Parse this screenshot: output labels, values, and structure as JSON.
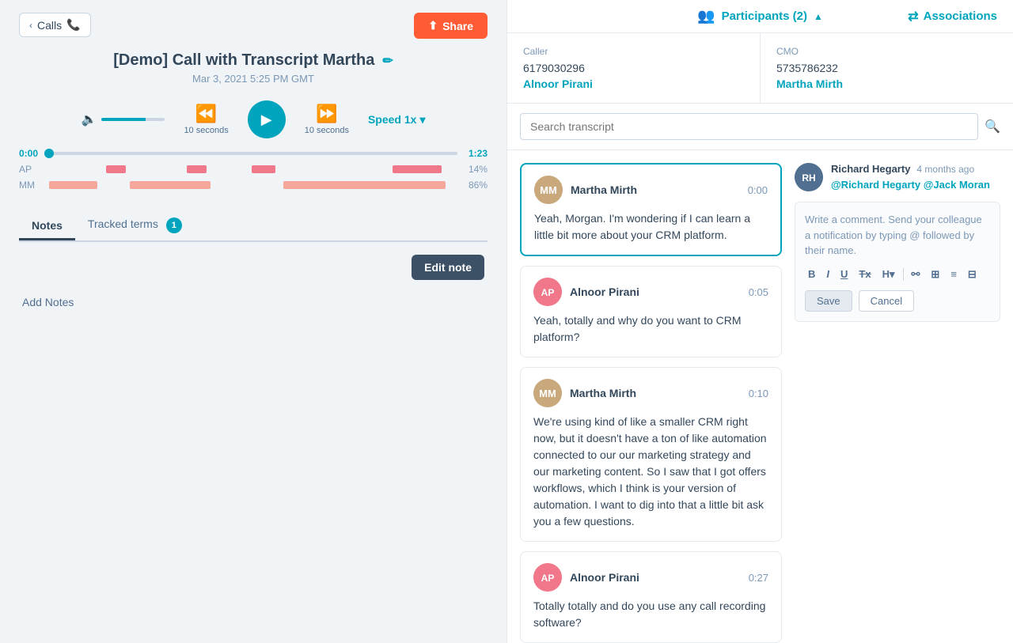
{
  "left": {
    "calls_btn": "Calls",
    "share_btn": "Share",
    "call_title": "[Demo] Call with Transcript Martha",
    "call_date": "Mar 3, 2021 5:25 PM GMT",
    "skip_back_label": "10 seconds",
    "skip_fwd_label": "10 seconds",
    "speed_label": "Speed 1x",
    "time_start": "0:00",
    "time_end": "1:23",
    "speaker_ap": "AP",
    "speaker_mm": "MM",
    "pct_ap": "14%",
    "pct_mm": "86%",
    "tab_notes": "Notes",
    "tab_tracked": "Tracked terms",
    "tracked_count": "1",
    "edit_note_btn": "Edit note",
    "add_notes": "Add Notes"
  },
  "right": {
    "participants_label": "Participants (2)",
    "associations_label": "Associations",
    "caller_label": "Caller",
    "caller_phone": "6179030296",
    "caller_name": "Alnoor Pirani",
    "cmo_label": "CMO",
    "cmo_phone": "5735786232",
    "cmo_name": "Martha Mirth",
    "search_placeholder": "Search transcript",
    "transcript": [
      {
        "speaker": "Martha Mirth",
        "initials": "MM",
        "time": "0:00",
        "text": "Yeah, Morgan. I'm wondering if I can learn a little bit more about your CRM platform.",
        "active": true,
        "avatar_type": "mm"
      },
      {
        "speaker": "Alnoor Pirani",
        "initials": "AP",
        "time": "0:05",
        "text": "Yeah, totally and why do you want to CRM platform?",
        "active": false,
        "avatar_type": "ap"
      },
      {
        "speaker": "Martha Mirth",
        "initials": "MM",
        "time": "0:10",
        "text": "We're using kind of like a smaller CRM right now, but it doesn't have a ton of like automation connected to our our marketing strategy and our marketing content. So I saw that I got offers workflows, which I think is your version of automation. I want to dig into that a little bit ask you a few questions.",
        "active": false,
        "avatar_type": "mm"
      },
      {
        "speaker": "Alnoor Pirani",
        "initials": "AP",
        "time": "0:27",
        "text": "Totally totally and do you use any call recording software?",
        "active": false,
        "avatar_type": "ap"
      }
    ],
    "comment": {
      "commenter": "Richard Hegarty",
      "time_ago": "4 months ago",
      "mention1": "@Richard Hegarty",
      "mention2": "@Jack Moran",
      "write_placeholder": "Write a comment. Send your colleague a notification by typing @ followed by their name.",
      "save_btn": "Save",
      "cancel_btn": "Cancel"
    }
  }
}
